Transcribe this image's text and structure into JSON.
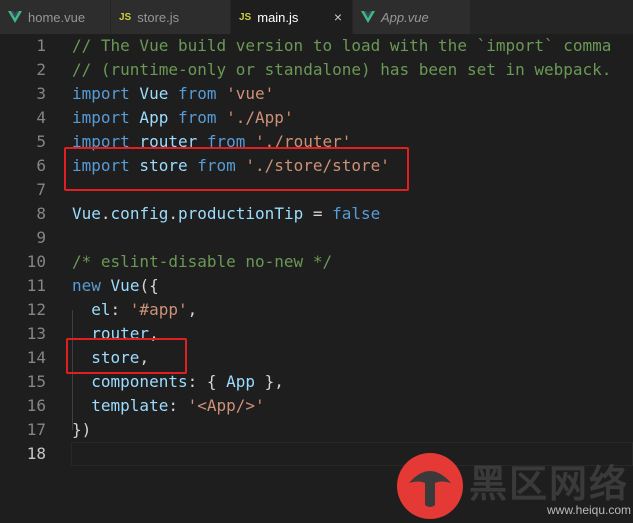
{
  "tabs": [
    {
      "label": "home.vue",
      "icon": "vue-icon",
      "active": false,
      "italic": false
    },
    {
      "label": "store.js",
      "icon": "js-icon",
      "active": false,
      "italic": false
    },
    {
      "label": "main.js",
      "icon": "js-icon",
      "active": true,
      "italic": false
    },
    {
      "label": "App.vue",
      "icon": "vue-icon",
      "active": false,
      "italic": true
    }
  ],
  "js_badge": "JS",
  "close_glyph": "×",
  "editor": {
    "lines": [
      {
        "n": "1",
        "tokens": [
          {
            "t": "// The Vue build version to load with the `import` comma",
            "c": "cmt"
          }
        ]
      },
      {
        "n": "2",
        "tokens": [
          {
            "t": "// (runtime-only or standalone) has been set in webpack.",
            "c": "cmt"
          }
        ]
      },
      {
        "n": "3",
        "tokens": [
          {
            "t": "import",
            "c": "kw"
          },
          {
            "t": " Vue ",
            "c": "id"
          },
          {
            "t": "from",
            "c": "kw"
          },
          {
            "t": " ",
            "c": ""
          },
          {
            "t": "'vue'",
            "c": "str"
          }
        ]
      },
      {
        "n": "4",
        "tokens": [
          {
            "t": "import",
            "c": "kw"
          },
          {
            "t": " App ",
            "c": "id"
          },
          {
            "t": "from",
            "c": "kw"
          },
          {
            "t": " ",
            "c": ""
          },
          {
            "t": "'./App'",
            "c": "str"
          }
        ]
      },
      {
        "n": "5",
        "tokens": [
          {
            "t": "import",
            "c": "kw"
          },
          {
            "t": " router ",
            "c": "id"
          },
          {
            "t": "from",
            "c": "kw"
          },
          {
            "t": " ",
            "c": ""
          },
          {
            "t": "'./router'",
            "c": "str"
          }
        ]
      },
      {
        "n": "6",
        "tokens": [
          {
            "t": "import",
            "c": "kw"
          },
          {
            "t": " store ",
            "c": "id"
          },
          {
            "t": "from",
            "c": "kw"
          },
          {
            "t": " ",
            "c": ""
          },
          {
            "t": "'./store/store'",
            "c": "str"
          }
        ]
      },
      {
        "n": "7",
        "tokens": []
      },
      {
        "n": "8",
        "tokens": [
          {
            "t": "Vue",
            "c": "id"
          },
          {
            "t": ".",
            "c": ""
          },
          {
            "t": "config",
            "c": "id"
          },
          {
            "t": ".",
            "c": ""
          },
          {
            "t": "productionTip",
            "c": "id"
          },
          {
            "t": " = ",
            "c": ""
          },
          {
            "t": "false",
            "c": "kw"
          }
        ]
      },
      {
        "n": "9",
        "tokens": []
      },
      {
        "n": "10",
        "tokens": [
          {
            "t": "/* eslint-disable no-new */",
            "c": "cmt"
          }
        ]
      },
      {
        "n": "11",
        "tokens": [
          {
            "t": "new",
            "c": "kw"
          },
          {
            "t": " ",
            "c": ""
          },
          {
            "t": "Vue",
            "c": "id"
          },
          {
            "t": "({",
            "c": ""
          }
        ]
      },
      {
        "n": "12",
        "tokens": [
          {
            "t": "  ",
            "c": ""
          },
          {
            "t": "el",
            "c": "id"
          },
          {
            "t": ": ",
            "c": ""
          },
          {
            "t": "'#app'",
            "c": "str"
          },
          {
            "t": ",",
            "c": ""
          }
        ]
      },
      {
        "n": "13",
        "tokens": [
          {
            "t": "  ",
            "c": ""
          },
          {
            "t": "router",
            "c": "id"
          },
          {
            "t": ",",
            "c": ""
          }
        ]
      },
      {
        "n": "14",
        "tokens": [
          {
            "t": "  ",
            "c": ""
          },
          {
            "t": "store",
            "c": "id"
          },
          {
            "t": ",",
            "c": ""
          }
        ]
      },
      {
        "n": "15",
        "tokens": [
          {
            "t": "  ",
            "c": ""
          },
          {
            "t": "components",
            "c": "id"
          },
          {
            "t": ": { ",
            "c": ""
          },
          {
            "t": "App",
            "c": "id"
          },
          {
            "t": " },",
            "c": ""
          }
        ]
      },
      {
        "n": "16",
        "tokens": [
          {
            "t": "  ",
            "c": ""
          },
          {
            "t": "template",
            "c": "id"
          },
          {
            "t": ": ",
            "c": ""
          },
          {
            "t": "'<App/>'",
            "c": "str"
          }
        ]
      },
      {
        "n": "17",
        "tokens": [
          {
            "t": "})",
            "c": ""
          }
        ]
      },
      {
        "n": "18",
        "tokens": []
      }
    ],
    "current_line": "18"
  },
  "watermark": {
    "title": "黑区网络",
    "subtitle": "www.heiqu.com"
  },
  "colors": {
    "background": "#1e1e1e",
    "tab_bar": "#252526",
    "keyword": "#569cd6",
    "string": "#ce9178",
    "comment": "#6a9955",
    "identifier": "#9cdcfe",
    "highlight": "#e02020",
    "vue_green": "#41b883",
    "js_yellow": "#cbcb41"
  }
}
